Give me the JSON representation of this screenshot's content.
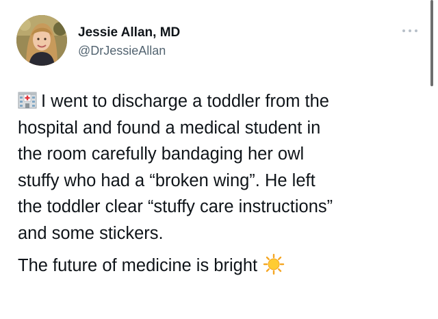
{
  "author": {
    "name": "Jessie Allan, MD",
    "handle": "@DrJessieAllan"
  },
  "icons": {
    "more": "more-options-icon",
    "hospital": "hospital-emoji-icon",
    "sun": "sun-emoji-icon"
  },
  "tweet": {
    "paragraph1_lines": [
      "I went to discharge a toddler from the",
      "hospital and found a medical student in",
      "the room carefully bandaging her owl",
      "stuffy who had a “broken wing”. He left",
      "the toddler clear “stuffy care instructions”",
      "and some stickers."
    ],
    "paragraph2": "The future of medicine is bright"
  },
  "colors": {
    "text": "#0f1419",
    "secondary": "#536471",
    "background": "#ffffff"
  }
}
